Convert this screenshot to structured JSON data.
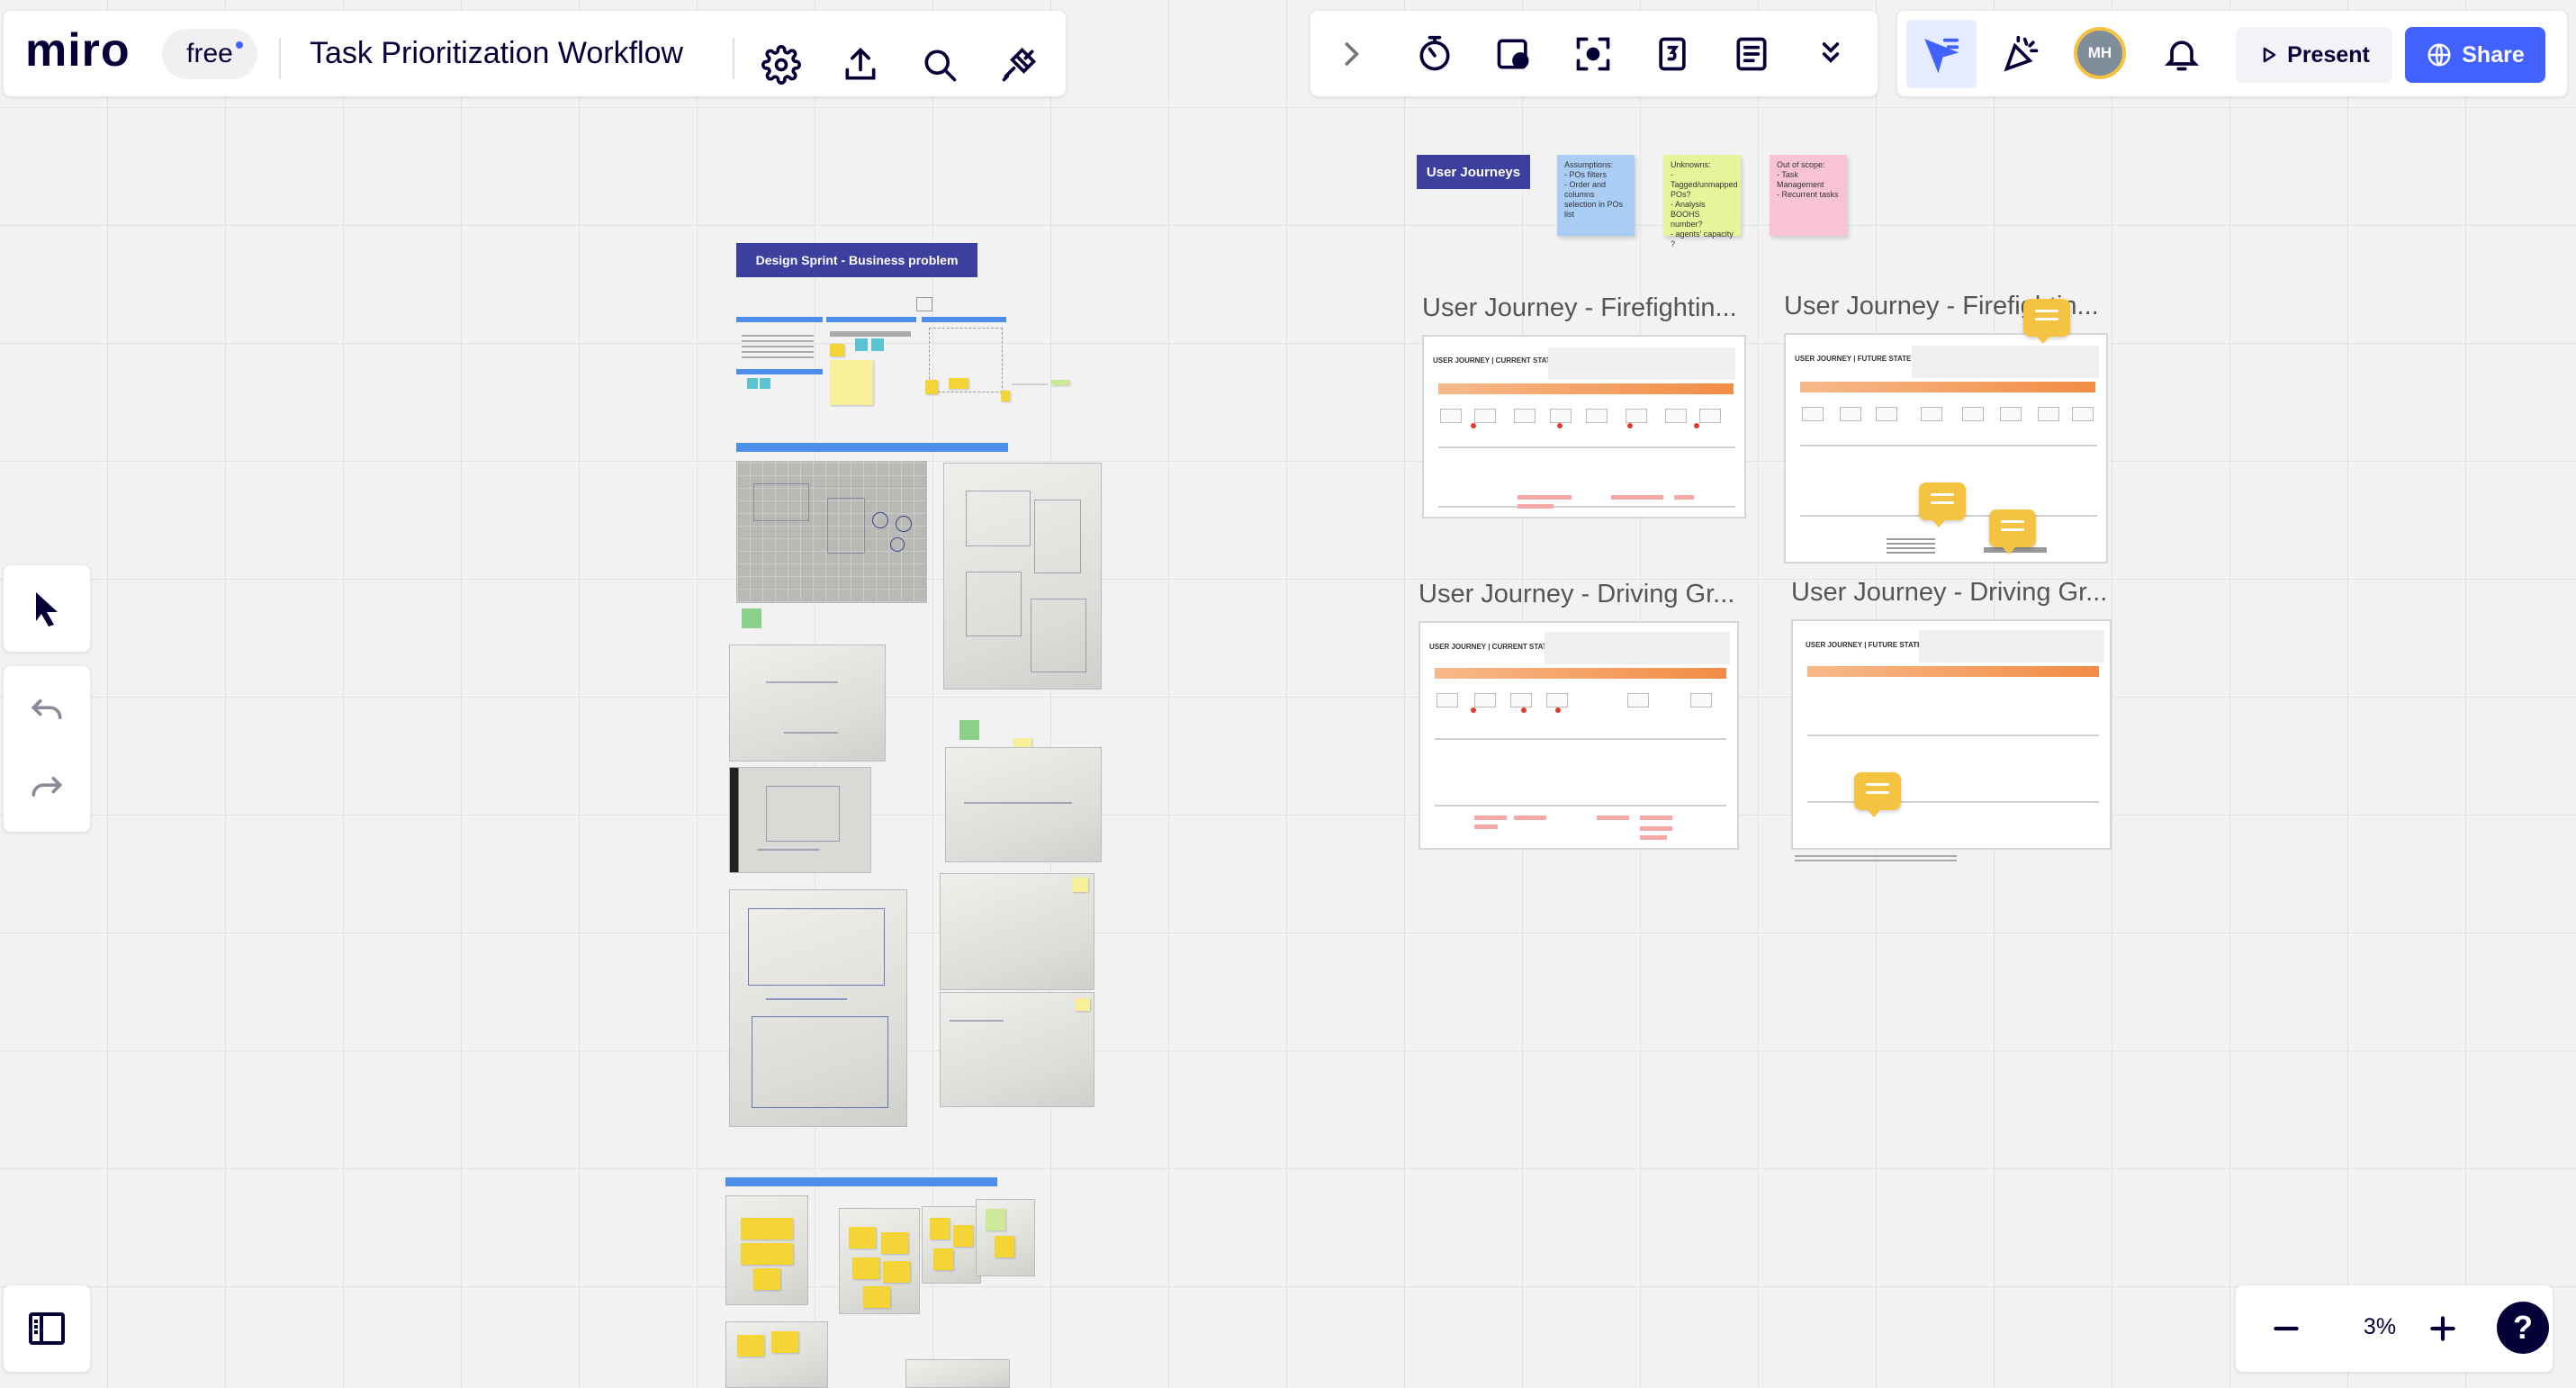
{
  "app": {
    "logo": "miro",
    "plan_badge": "free",
    "board_title": "Task Prioritization Workflow",
    "accent_color": "#4262ff"
  },
  "toolbar_left_icons": [
    "settings-icon",
    "export-icon",
    "search-icon",
    "plug-icon"
  ],
  "toolbar_center_icons": [
    "chevron-right-icon",
    "timer-icon",
    "card-icon",
    "focus-icon",
    "counter-icon",
    "notes-icon",
    "chevrons-down-icon"
  ],
  "toolbar_right": {
    "avatar_initials": "MH",
    "present_label": "Present",
    "share_label": "Share"
  },
  "zoom": {
    "value": "3%"
  },
  "canvas": {
    "labels": {
      "user_journeys": "User Journeys",
      "design_sprint": "Design Sprint - Business problem"
    },
    "stickies": [
      {
        "text": "Assumptions:\n- POs filters\n- Order and columns\n  selection in POs list",
        "color": "#a9cdf5"
      },
      {
        "text": "Unknowns:\n- Tagged/unmapped\n  POs?\n- Analysis BOOHS\n  number?\n- agents' capacity ?",
        "color": "#e6f59a"
      },
      {
        "text": "Out of scope:\n- Task Management\n- Recurrent tasks",
        "color": "#f7c3d5"
      }
    ],
    "journey_frames": [
      {
        "title": "User Journey - Firefightin...",
        "subtitle": "USER JOURNEY | CURRENT STATE"
      },
      {
        "title": "User Journey - Firefightin...",
        "subtitle": "USER JOURNEY | FUTURE STATE"
      },
      {
        "title": "User Journey - Driving Gr...",
        "subtitle": "USER JOURNEY | CURRENT STATE"
      },
      {
        "title": "User Journey - Driving Gr...",
        "subtitle": "USER JOURNEY | FUTURE STATE"
      }
    ]
  }
}
